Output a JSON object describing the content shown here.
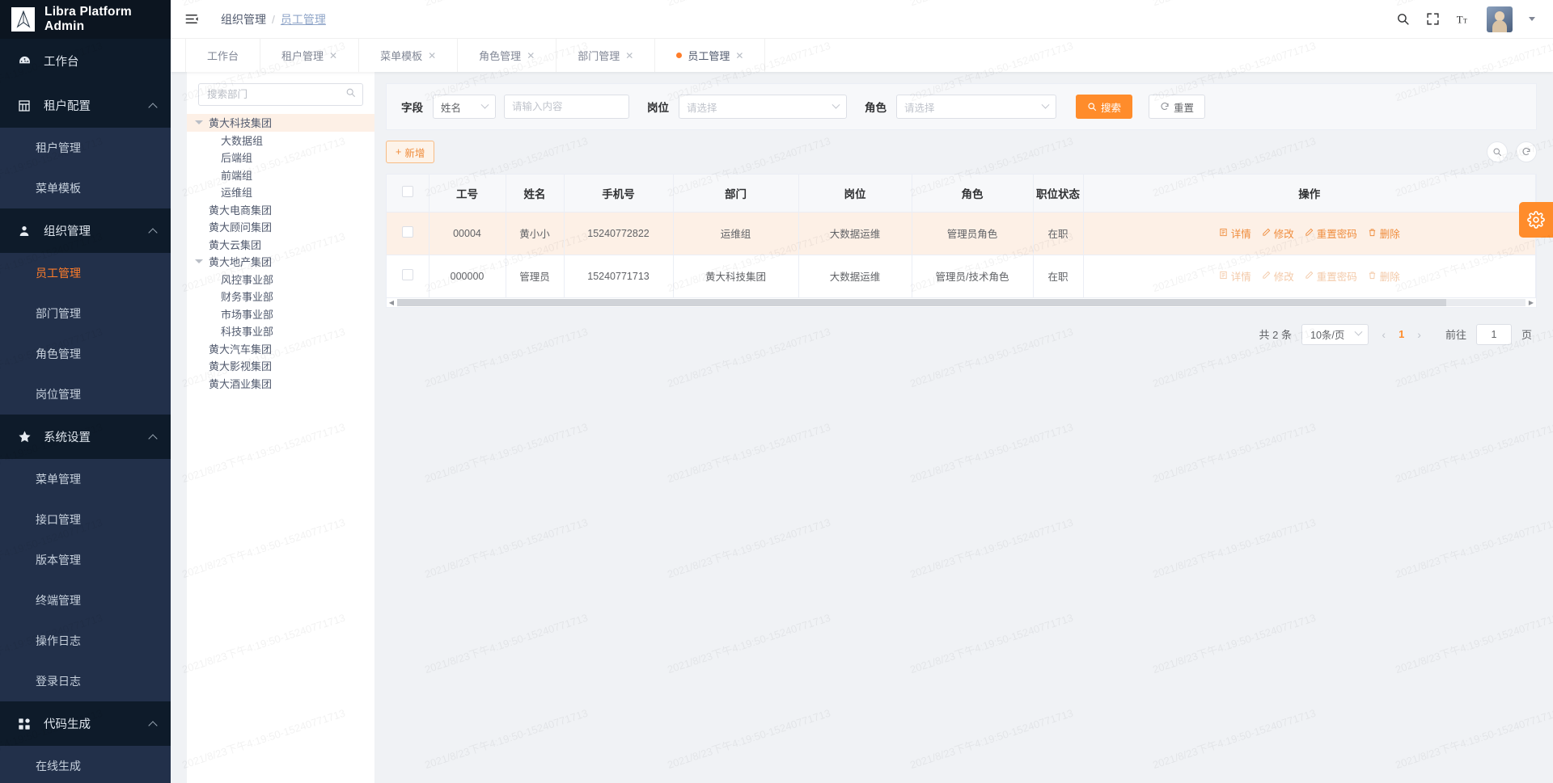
{
  "app": {
    "title": "Libra Platform Admin"
  },
  "watermark": {
    "text": "2021/8/23下午4:19:50-15240771713"
  },
  "sidebar": {
    "groups": [
      {
        "icon": "dashboard-icon",
        "label": "工作台",
        "collapsible": false,
        "items": []
      },
      {
        "icon": "grid-icon",
        "label": "租户配置",
        "collapsible": true,
        "items": [
          {
            "label": "租户管理",
            "active": false
          },
          {
            "label": "菜单模板",
            "active": false
          }
        ]
      },
      {
        "icon": "user-icon",
        "label": "组织管理",
        "collapsible": true,
        "items": [
          {
            "label": "员工管理",
            "active": true
          },
          {
            "label": "部门管理",
            "active": false
          },
          {
            "label": "角色管理",
            "active": false
          },
          {
            "label": "岗位管理",
            "active": false
          }
        ]
      },
      {
        "icon": "star-icon",
        "label": "系统设置",
        "collapsible": true,
        "items": [
          {
            "label": "菜单管理",
            "active": false
          },
          {
            "label": "接口管理",
            "active": false
          },
          {
            "label": "版本管理",
            "active": false
          },
          {
            "label": "终端管理",
            "active": false
          },
          {
            "label": "操作日志",
            "active": false
          },
          {
            "label": "登录日志",
            "active": false
          }
        ]
      },
      {
        "icon": "blocks-icon",
        "label": "代码生成",
        "collapsible": true,
        "items": [
          {
            "label": "在线生成",
            "active": false
          }
        ]
      }
    ]
  },
  "header": {
    "menu_icon": "hamburger-icon",
    "breadcrumb": {
      "parent": "组织管理",
      "separator": "/",
      "current": "员工管理"
    },
    "icons": [
      "search-icon",
      "fullscreen-icon",
      "font-size-icon"
    ]
  },
  "tabs": [
    {
      "label": "工作台",
      "closable": false,
      "active": false
    },
    {
      "label": "租户管理",
      "closable": true,
      "active": false
    },
    {
      "label": "菜单模板",
      "closable": true,
      "active": false
    },
    {
      "label": "角色管理",
      "closable": true,
      "active": false
    },
    {
      "label": "部门管理",
      "closable": true,
      "active": false
    },
    {
      "label": "员工管理",
      "closable": true,
      "active": true
    }
  ],
  "dept_panel": {
    "search_placeholder": "搜索部门",
    "search_value": "",
    "tree": [
      {
        "label": "黄大科技集团",
        "level": 1,
        "expandable": true,
        "selected": true
      },
      {
        "label": "大数据组",
        "level": 2,
        "expandable": false,
        "selected": false
      },
      {
        "label": "后端组",
        "level": 2,
        "expandable": false,
        "selected": false
      },
      {
        "label": "前端组",
        "level": 2,
        "expandable": false,
        "selected": false
      },
      {
        "label": "运维组",
        "level": 2,
        "expandable": false,
        "selected": false
      },
      {
        "label": "黄大电商集团",
        "level": 1,
        "expandable": false,
        "selected": false
      },
      {
        "label": "黄大顾问集团",
        "level": 1,
        "expandable": false,
        "selected": false
      },
      {
        "label": "黄大云集团",
        "level": 1,
        "expandable": false,
        "selected": false
      },
      {
        "label": "黄大地产集团",
        "level": 1,
        "expandable": true,
        "selected": false
      },
      {
        "label": "风控事业部",
        "level": 2,
        "expandable": false,
        "selected": false
      },
      {
        "label": "财务事业部",
        "level": 2,
        "expandable": false,
        "selected": false
      },
      {
        "label": "市场事业部",
        "level": 2,
        "expandable": false,
        "selected": false
      },
      {
        "label": "科技事业部",
        "level": 2,
        "expandable": false,
        "selected": false
      },
      {
        "label": "黄大汽车集团",
        "level": 1,
        "expandable": false,
        "selected": false
      },
      {
        "label": "黄大影视集团",
        "level": 1,
        "expandable": false,
        "selected": false
      },
      {
        "label": "黄大酒业集团",
        "level": 1,
        "expandable": false,
        "selected": false
      }
    ]
  },
  "filter": {
    "field_label": "字段",
    "field_select_value": "姓名",
    "keyword_placeholder": "请输入内容",
    "keyword_value": "",
    "post_label": "岗位",
    "post_select_placeholder": "请选择",
    "role_label": "角色",
    "role_select_placeholder": "请选择",
    "search_button": "搜索",
    "reset_button": "重置"
  },
  "toolbar": {
    "add_button": "新增",
    "zoom_icon": "magnifier-icon",
    "refresh_icon": "refresh-icon"
  },
  "table": {
    "columns": [
      "",
      "工号",
      "姓名",
      "手机号",
      "部门",
      "岗位",
      "角色",
      "职位状态",
      "操作"
    ],
    "rows": [
      {
        "highlight": true,
        "checked": false,
        "工号": "00004",
        "姓名": "黄小小",
        "手机号": "15240772822",
        "部门": "运维组",
        "岗位": "大数据运维",
        "角色": "管理员角色",
        "职位状态": "在职",
        "actions": [
          {
            "label": "详情",
            "icon": "detail-icon",
            "disabled": false
          },
          {
            "label": "修改",
            "icon": "edit-icon",
            "disabled": false
          },
          {
            "label": "重置密码",
            "icon": "key-icon",
            "disabled": false
          },
          {
            "label": "删除",
            "icon": "trash-icon",
            "disabled": false
          }
        ]
      },
      {
        "highlight": false,
        "checked": false,
        "工号": "000000",
        "姓名": "管理员",
        "手机号": "15240771713",
        "部门": "黄大科技集团",
        "岗位": "大数据运维",
        "角色": "管理员/技术角色",
        "职位状态": "在职",
        "actions": [
          {
            "label": "详情",
            "icon": "detail-icon",
            "disabled": true
          },
          {
            "label": "修改",
            "icon": "edit-icon",
            "disabled": true
          },
          {
            "label": "重置密码",
            "icon": "key-icon",
            "disabled": true
          },
          {
            "label": "删除",
            "icon": "trash-icon",
            "disabled": true
          }
        ]
      }
    ]
  },
  "pagination": {
    "total_text": "共 2 条",
    "page_size": "10条/页",
    "current_page": "1",
    "goto_label": "前往",
    "goto_value": "1",
    "page_unit": "页"
  },
  "fab": {
    "icon": "gear-icon"
  },
  "colors": {
    "accent": "#ff8c2b",
    "sidebar_bg": "#1f2d3d",
    "sidebar_dark": "#0e1b2a",
    "highlight_row": "#fdf0e6"
  }
}
